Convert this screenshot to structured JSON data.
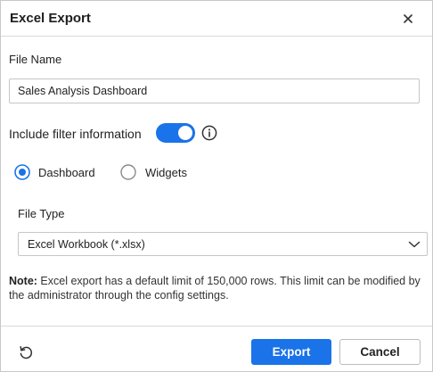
{
  "dialog": {
    "title": "Excel Export",
    "close_icon": "close-icon"
  },
  "file_name": {
    "label": "File Name",
    "value": "Sales Analysis Dashboard"
  },
  "filter": {
    "label": "Include filter information",
    "enabled": true,
    "info_icon": "info-icon"
  },
  "scope": {
    "options": [
      {
        "label": "Dashboard",
        "selected": true
      },
      {
        "label": "Widgets",
        "selected": false
      }
    ]
  },
  "file_type": {
    "label": "File Type",
    "selected": "Excel Workbook (*.xlsx)"
  },
  "note": {
    "prefix": "Note:",
    "text": " Excel export has a default limit of 150,000 rows. This limit can be modified by the administrator through the config settings."
  },
  "footer": {
    "reset_icon": "reset-icon",
    "export_label": "Export",
    "cancel_label": "Cancel"
  },
  "colors": {
    "accent": "#1a73e8",
    "border": "#c6c6c6"
  }
}
